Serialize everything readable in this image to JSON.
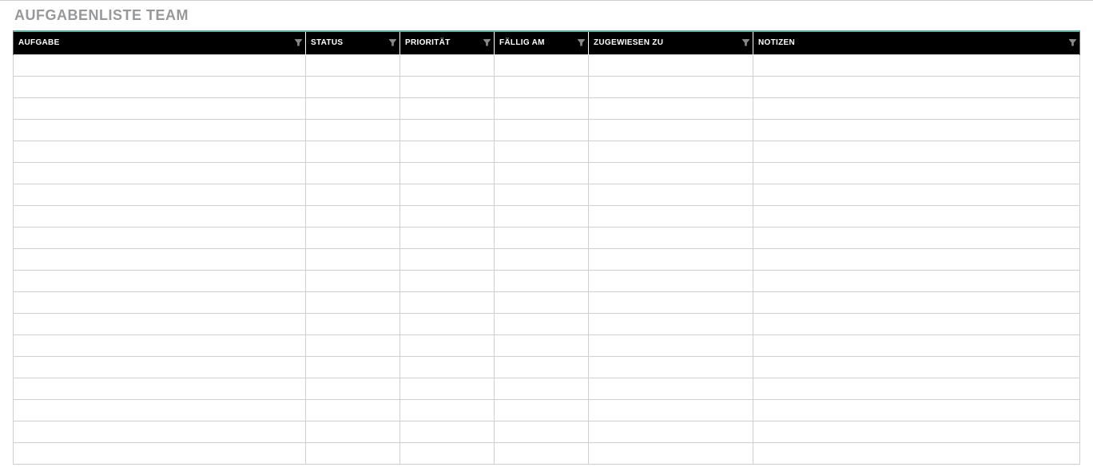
{
  "page": {
    "title": "AUFGABENLISTE TEAM"
  },
  "table": {
    "columns": [
      {
        "key": "aufgabe",
        "label": "AUFGABE"
      },
      {
        "key": "status",
        "label": "STATUS"
      },
      {
        "key": "prioritaet",
        "label": "PRIORITÄT"
      },
      {
        "key": "faellig",
        "label": "FÄLLIG AM"
      },
      {
        "key": "zugewiesen",
        "label": "ZUGEWIESEN ZU"
      },
      {
        "key": "notizen",
        "label": "NOTIZEN"
      }
    ],
    "rows": [
      {
        "aufgabe": "",
        "status": "",
        "prioritaet": "",
        "faellig": "",
        "zugewiesen": "",
        "notizen": ""
      },
      {
        "aufgabe": "",
        "status": "",
        "prioritaet": "",
        "faellig": "",
        "zugewiesen": "",
        "notizen": ""
      },
      {
        "aufgabe": "",
        "status": "",
        "prioritaet": "",
        "faellig": "",
        "zugewiesen": "",
        "notizen": ""
      },
      {
        "aufgabe": "",
        "status": "",
        "prioritaet": "",
        "faellig": "",
        "zugewiesen": "",
        "notizen": ""
      },
      {
        "aufgabe": "",
        "status": "",
        "prioritaet": "",
        "faellig": "",
        "zugewiesen": "",
        "notizen": ""
      },
      {
        "aufgabe": "",
        "status": "",
        "prioritaet": "",
        "faellig": "",
        "zugewiesen": "",
        "notizen": ""
      },
      {
        "aufgabe": "",
        "status": "",
        "prioritaet": "",
        "faellig": "",
        "zugewiesen": "",
        "notizen": ""
      },
      {
        "aufgabe": "",
        "status": "",
        "prioritaet": "",
        "faellig": "",
        "zugewiesen": "",
        "notizen": ""
      },
      {
        "aufgabe": "",
        "status": "",
        "prioritaet": "",
        "faellig": "",
        "zugewiesen": "",
        "notizen": ""
      },
      {
        "aufgabe": "",
        "status": "",
        "prioritaet": "",
        "faellig": "",
        "zugewiesen": "",
        "notizen": ""
      },
      {
        "aufgabe": "",
        "status": "",
        "prioritaet": "",
        "faellig": "",
        "zugewiesen": "",
        "notizen": ""
      },
      {
        "aufgabe": "",
        "status": "",
        "prioritaet": "",
        "faellig": "",
        "zugewiesen": "",
        "notizen": ""
      },
      {
        "aufgabe": "",
        "status": "",
        "prioritaet": "",
        "faellig": "",
        "zugewiesen": "",
        "notizen": ""
      },
      {
        "aufgabe": "",
        "status": "",
        "prioritaet": "",
        "faellig": "",
        "zugewiesen": "",
        "notizen": ""
      },
      {
        "aufgabe": "",
        "status": "",
        "prioritaet": "",
        "faellig": "",
        "zugewiesen": "",
        "notizen": ""
      },
      {
        "aufgabe": "",
        "status": "",
        "prioritaet": "",
        "faellig": "",
        "zugewiesen": "",
        "notizen": ""
      },
      {
        "aufgabe": "",
        "status": "",
        "prioritaet": "",
        "faellig": "",
        "zugewiesen": "",
        "notizen": ""
      },
      {
        "aufgabe": "",
        "status": "",
        "prioritaet": "",
        "faellig": "",
        "zugewiesen": "",
        "notizen": ""
      },
      {
        "aufgabe": "",
        "status": "",
        "prioritaet": "",
        "faellig": "",
        "zugewiesen": "",
        "notizen": ""
      }
    ]
  }
}
